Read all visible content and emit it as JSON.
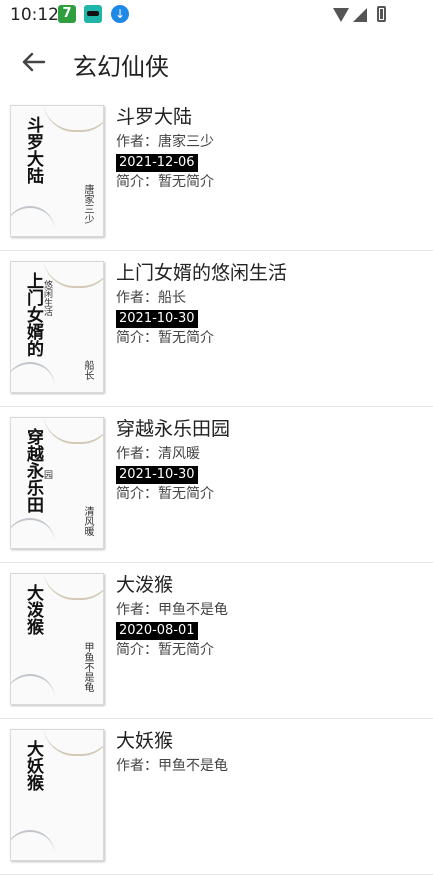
{
  "status": {
    "time": "10:12",
    "icons": [
      "green-app-icon",
      "teal-app-icon",
      "download-icon",
      "wifi-icon",
      "signal-icon",
      "battery-icon"
    ]
  },
  "header": {
    "title": "玄幻仙侠",
    "back_icon": "back-arrow-icon"
  },
  "books": [
    {
      "title": "斗罗大陆",
      "author": "作者：唐家三少",
      "date": "2021-12-06",
      "intro": "简介：暂无简介",
      "cover_title": "斗罗大陆",
      "cover_sub": "",
      "cover_author": "唐家三少"
    },
    {
      "title": "上门女婿的悠闲生活",
      "author": "作者：船长",
      "date": "2021-10-30",
      "intro": "简介：暂无简介",
      "cover_title": "上门女婿的",
      "cover_sub": "悠闲生活",
      "cover_author": "船长"
    },
    {
      "title": "穿越永乐田园",
      "author": "作者：清风暖",
      "date": "2021-10-30",
      "intro": "简介：暂无简介",
      "cover_title": "穿越永乐田",
      "cover_sub": "园",
      "cover_author": "清风暖"
    },
    {
      "title": "大泼猴",
      "author": "作者：甲鱼不是龟",
      "date": "2020-08-01",
      "intro": "简介：暂无简介",
      "cover_title": "大泼猴",
      "cover_sub": "",
      "cover_author": "甲鱼不是龟"
    },
    {
      "title": "大妖猴",
      "author": "作者：甲鱼不是龟",
      "date": "",
      "intro": "",
      "cover_title": "大妖猴",
      "cover_sub": "",
      "cover_author": ""
    }
  ]
}
